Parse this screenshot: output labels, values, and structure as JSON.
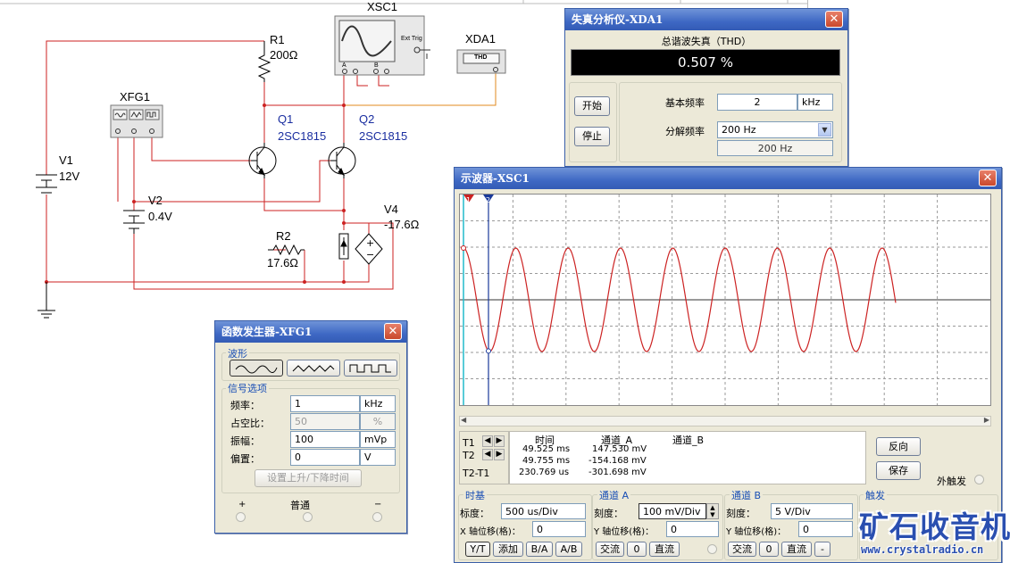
{
  "schematic": {
    "r1": {
      "name": "R1",
      "value": "200Ω"
    },
    "xsc1": {
      "name": "XSC1",
      "ext_trig": "Ext Trig",
      "ch_a": "A",
      "ch_b": "B"
    },
    "xda1": {
      "name": "XDA1",
      "display": "THD"
    },
    "xfg1": {
      "name": "XFG1"
    },
    "q1": {
      "name": "Q1",
      "model": "2SC1815"
    },
    "q2": {
      "name": "Q2",
      "model": "2SC1815"
    },
    "v1": {
      "name": "V1",
      "value": "12V"
    },
    "v2": {
      "name": "V2",
      "value": "0.4V"
    },
    "v4": {
      "name": "V4",
      "value": "-17.6Ω"
    },
    "r2": {
      "name": "R2",
      "value": "17.6Ω"
    },
    "colors": {
      "wire_red": "#cc2222",
      "wire_orange": "#e08a1e",
      "component": "#000000"
    }
  },
  "distortion": {
    "title": "失真分析仪-XDA1",
    "heading": "总谐波失真（THD）",
    "value": "0.507 %",
    "start_button": "开始",
    "stop_button": "停止",
    "fundamental_label": "基本频率",
    "fundamental_value": "2",
    "fundamental_unit": "kHz",
    "resolution_label": "分解频率",
    "resolution_value": "200 Hz",
    "resolution_readout": "200 Hz"
  },
  "funcgen": {
    "title": "函数发生器-XFG1",
    "waveform_group": "波形",
    "signal_group": "信号选项",
    "frequency_label": "频率：",
    "frequency_value": "1",
    "frequency_unit": "kHz",
    "duty_label": "占空比：",
    "duty_value": "50",
    "duty_unit": "%",
    "amplitude_label": "振幅：",
    "amplitude_value": "100",
    "amplitude_unit": "mVp",
    "offset_label": "偏置：",
    "offset_value": "0",
    "offset_unit": "V",
    "rise_fall_button": "设置上升/下降时间",
    "plus": "+",
    "common": "普通",
    "minus": "−"
  },
  "scope": {
    "title": "示波器-XSC1",
    "cursor1": "1",
    "cursor2": "2",
    "wave_color": "#cc2222",
    "cursor1_color": "#22bbcc",
    "cursor2_color": "#1a3a9a",
    "readout": {
      "col_time": "时间",
      "col_a": "通道_A",
      "col_b": "通道_B",
      "t1_label": "T1",
      "t2_label": "T2",
      "t21_label": "T2-T1",
      "t1_time": "49.525 ms",
      "t1_a": "147.530 mV",
      "t2_time": "49.755 ms",
      "t2_a": "-154.168 mV",
      "t21_time": "230.769 us",
      "t21_a": "-301.698 mV"
    },
    "reverse_button": "反向",
    "save_button": "保存",
    "ext_trigger": "外触发",
    "timebase": {
      "title": "时基",
      "scale_label": "标度：",
      "scale_value": "500 us/Div",
      "xpos_label": "X 轴位移(格)：",
      "xpos_value": "0",
      "btn_yt": "Y/T",
      "btn_add": "添加",
      "btn_ba": "B/A",
      "btn_ab": "A/B"
    },
    "channel_a": {
      "title": "通道 A",
      "scale_label": "刻度：",
      "scale_value": "100 mV/Div",
      "ypos_label": "Y 轴位移(格)：",
      "ypos_value": "0",
      "btn_ac": "交流",
      "btn_zero": "0",
      "btn_dc": "直流"
    },
    "channel_b": {
      "title": "通道 B",
      "scale_label": "刻度：",
      "scale_value": "5  V/Div",
      "ypos_label": "Y 轴位移(格)：",
      "ypos_value": "0",
      "btn_ac": "交流",
      "btn_zero": "0",
      "btn_dc": "直流",
      "btn_minus": "-"
    },
    "trigger": {
      "title": "触发"
    }
  },
  "watermark": {
    "text": "矿石收音机",
    "url": "www.crystalradio.cn"
  }
}
